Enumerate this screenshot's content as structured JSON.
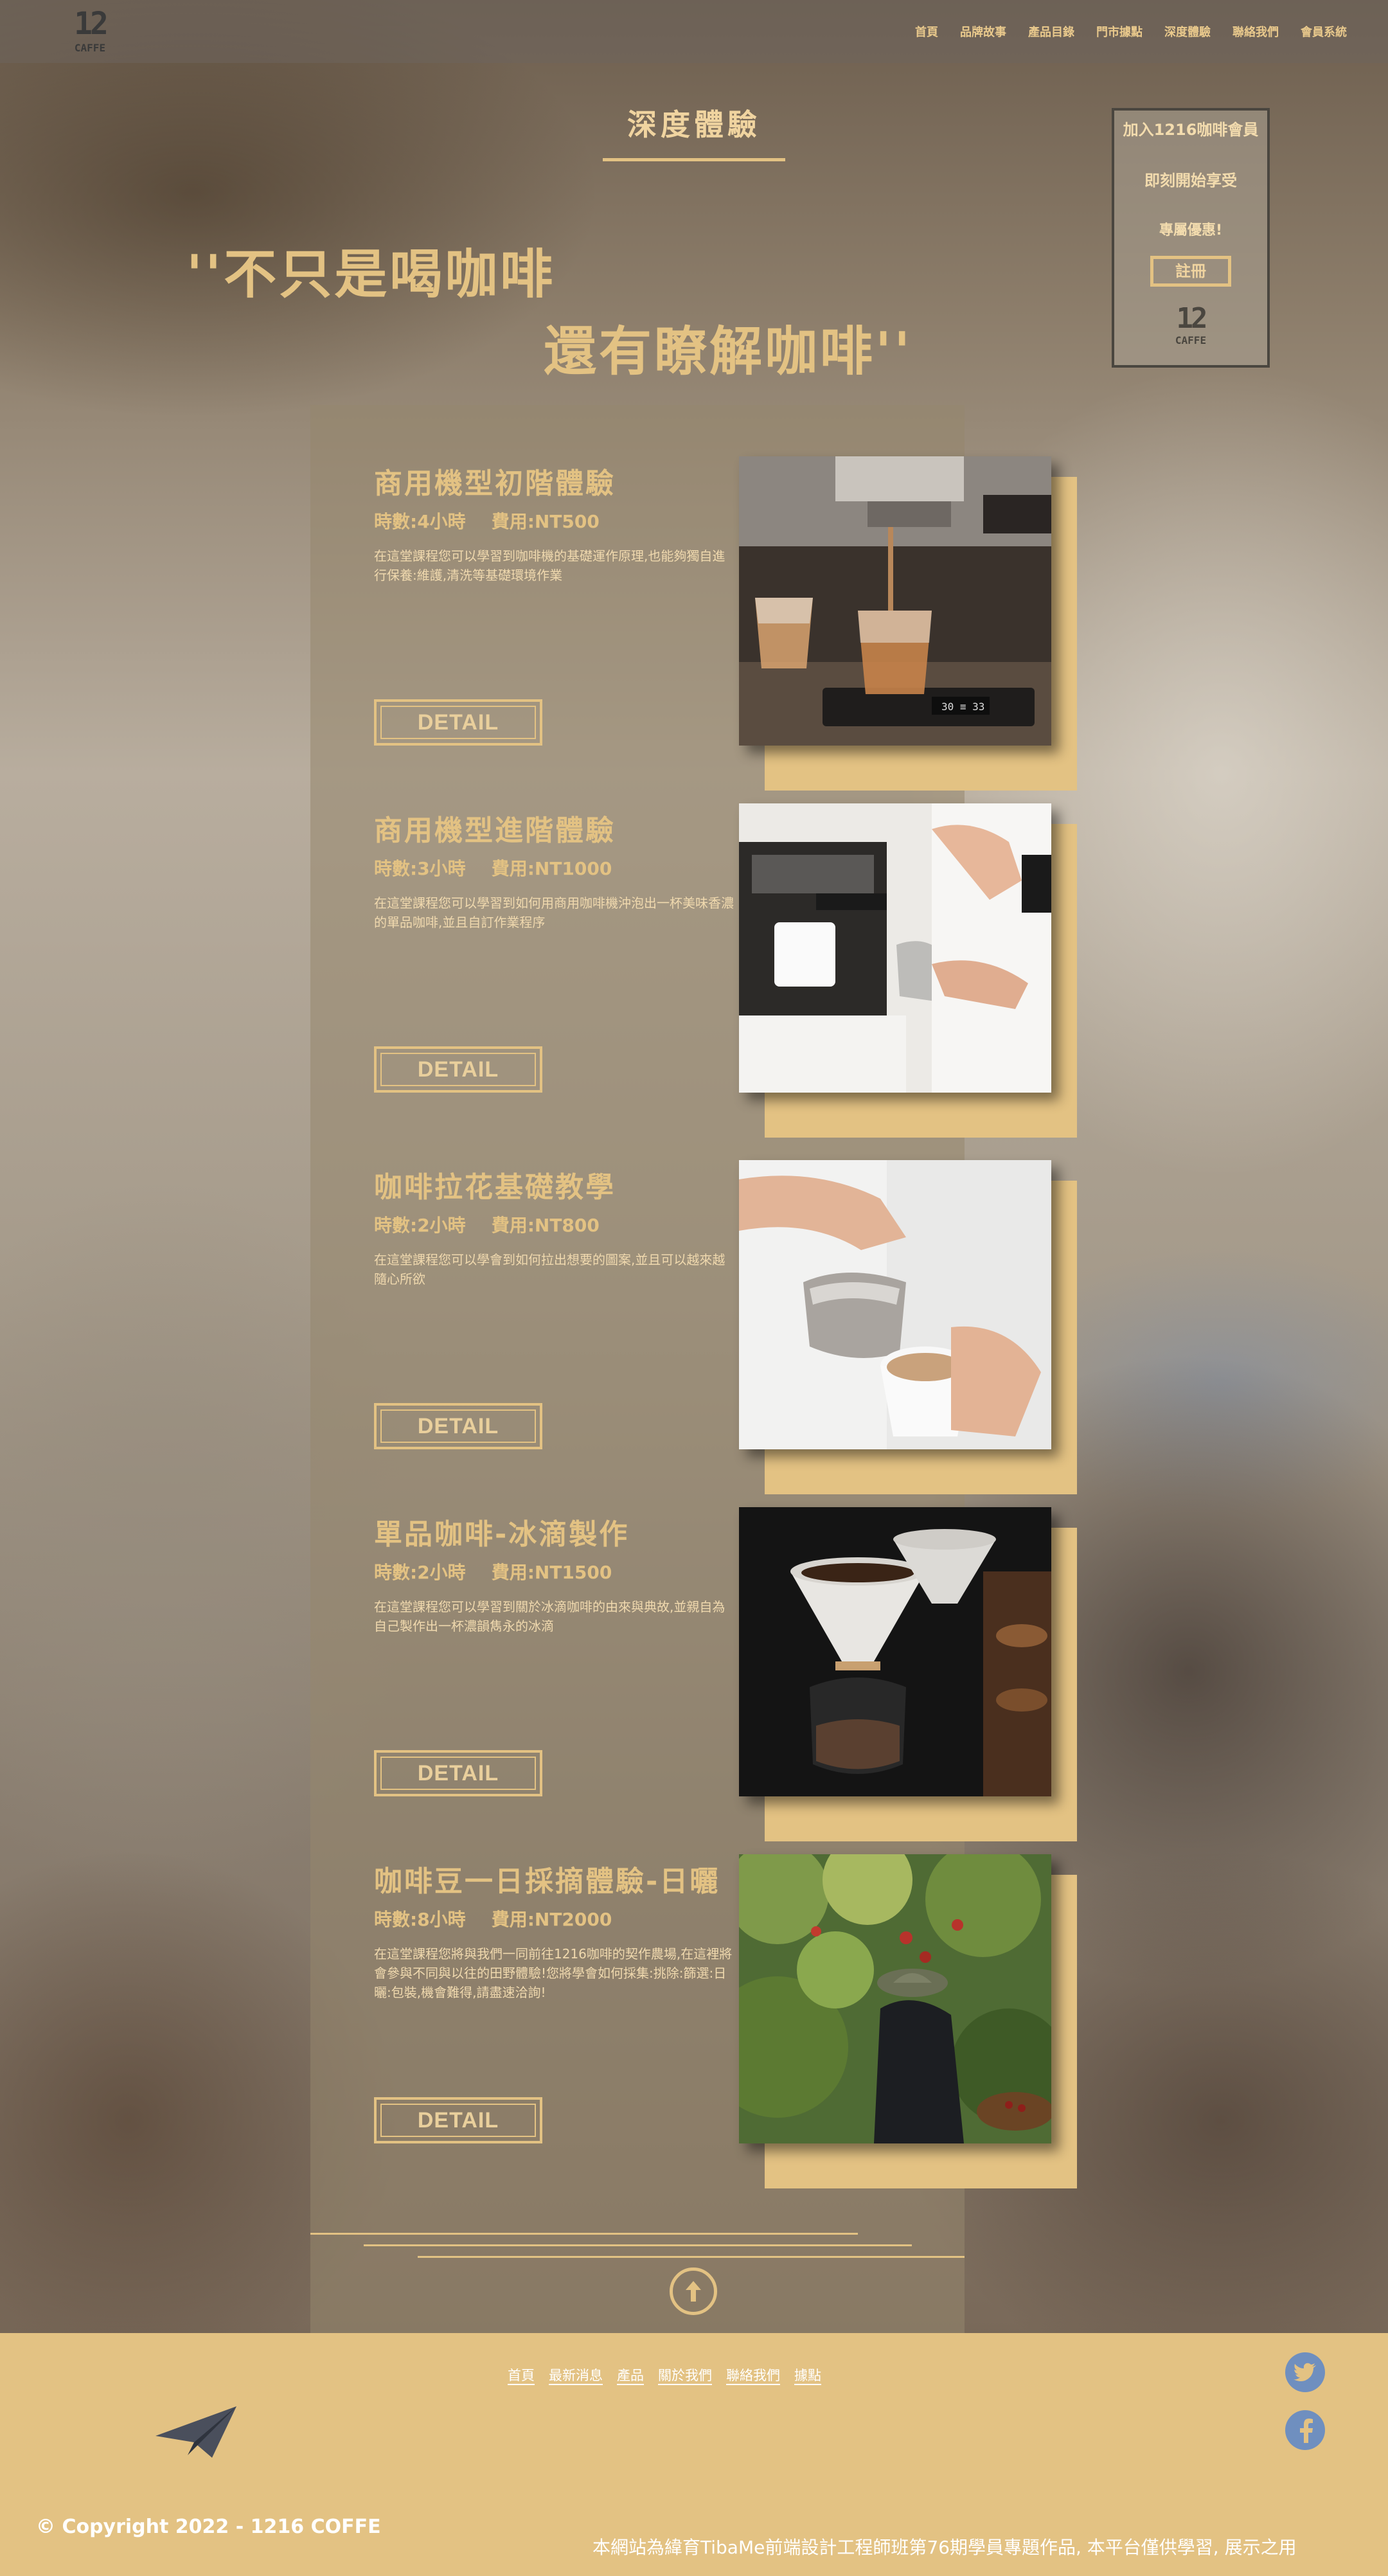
{
  "nav": {
    "logo_top": "12",
    "logo_bottom": "CAFFE",
    "items": [
      "首頁",
      "品牌故事",
      "產品目錄",
      "門市據點",
      "深度體驗",
      "聯絡我們",
      "會員系統"
    ]
  },
  "page_title": "深度體驗",
  "quote": {
    "line1": "''不只是喝咖啡",
    "line2": "還有瞭解咖啡''"
  },
  "member": {
    "line1": "加入1216咖啡會員",
    "line2": "即刻開始享受",
    "line3": "專屬優惠!",
    "register": "註冊",
    "logo_top": "12",
    "logo_bottom": "CAFFE"
  },
  "courses": [
    {
      "title": "商用機型初階體驗",
      "hours": "時數:4小時",
      "fee": "費用:NT500",
      "desc": "在這堂課程您可以學習到咖啡機的基礎運作原理,也能夠獨自進行保養:維護,清洗等基礎環境作業",
      "detail": "DETAIL",
      "image": "espresso-machine-photo"
    },
    {
      "title": "商用機型進階體驗",
      "hours": "時數:3小時",
      "fee": "費用:NT1000",
      "desc": "在這堂課程您可以學習到如何用商用咖啡機沖泡出一杯美味香濃的單品咖啡,並且自訂作業程序",
      "detail": "DETAIL",
      "image": "barista-steaming-milk-photo"
    },
    {
      "title": "咖啡拉花基礎教學",
      "hours": "時數:2小時",
      "fee": "費用:NT800",
      "desc": "在這堂課程您可以學會到如何拉出想要的圖案,並且可以越來越隨心所欲",
      "detail": "DETAIL",
      "image": "latte-art-pouring-photo"
    },
    {
      "title": "單品咖啡-冰滴製作",
      "hours": "時數:2小時",
      "fee": "費用:NT1500",
      "desc": "在這堂課程您可以學習到關於冰滴咖啡的由來與典故,並親自為自己製作出一杯濃韻雋永的冰滴",
      "detail": "DETAIL",
      "image": "pour-over-drippers-photo"
    },
    {
      "title": "咖啡豆一日採摘體驗-日曬",
      "hours": "時數:8小時",
      "fee": "費用:NT2000",
      "desc": "在這堂課程您將與我們一同前往1216咖啡的契作農場,在這裡將會參與不同與以往的田野體驗!您將學會如何採集:挑除:篩選:日曬:包裝,機會難得,請盡速洽詢!",
      "detail": "DETAIL",
      "image": "coffee-farm-picking-photo"
    }
  ],
  "footer": {
    "links": [
      "首頁",
      "最新消息",
      "產品",
      "關於我們",
      "聯絡我們",
      "據點"
    ],
    "copyright": "© Copyright 2022 - 1216 COFFE",
    "disclaimer": "本網站為緯育TibaMe前端設計工程師班第76期學員專題作品, 本平台僅供學習, 展示之用"
  },
  "colors": {
    "accent": "#e3c283",
    "footer_bg": "#e3c283",
    "social": "#6f8fbf"
  }
}
